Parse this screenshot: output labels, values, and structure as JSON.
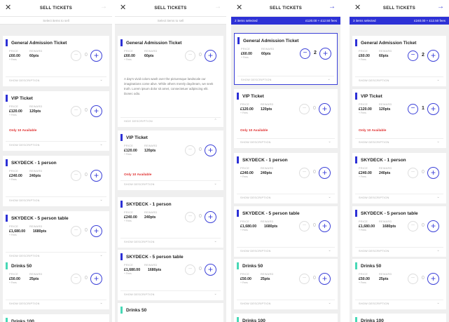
{
  "labels": {
    "close": "✕",
    "arrow": "→",
    "title": "SELL TICKETS",
    "subtitle": "Select items to sell",
    "price": "PRICE",
    "reward": "REWARD",
    "fees": "+ Fees",
    "show_description": "SHOW DESCRIPTION",
    "hide_description": "HIDE DESCRIPTION",
    "only_available": "Only 10 Available",
    "minus": "−",
    "plus": "+",
    "chevron": "⌄",
    "chevron_up": "⌃"
  },
  "screens": [
    {
      "id": "s1",
      "selection": null,
      "tickets": [
        {
          "name": "General Admission Ticket",
          "price": "£60.00",
          "reward": "60pts",
          "qty": "0"
        },
        {
          "name": "VIP Ticket",
          "price": "£120.00",
          "reward": "120pts",
          "qty": "0"
        },
        {
          "name": "SKYDECK - 1 person",
          "price": "£240.00",
          "reward": "240pts",
          "qty": "0"
        },
        {
          "name": "SKYDECK - 5 person table",
          "price": "£1,680.00",
          "reward": "1680pts",
          "qty": "0"
        },
        {
          "name": "Drinks 50",
          "price": "£50.00",
          "reward": "25pts",
          "qty": "0"
        },
        {
          "name": "Drinks 100"
        }
      ]
    },
    {
      "id": "s2",
      "selection": null,
      "description": "A day's vivid colors wash over the picturesque landscale our imaginations come alive. While others merely daydream, we seek truth. Lorem ipsum dolor sit amet, consectetuer adipiscing elit. Donec odio.",
      "tickets": [
        {
          "name": "General Admission Ticket",
          "price": "£60.00",
          "reward": "60pts",
          "qty": "0"
        },
        {
          "name": "VIP Ticket",
          "price": "£120.00",
          "reward": "120pts",
          "qty": "0"
        },
        {
          "name": "SKYDECK - 1 person",
          "price": "£240.00",
          "reward": "240pts",
          "qty": "0"
        },
        {
          "name": "SKYDECK - 5 person table",
          "price": "£1,680.00",
          "reward": "1680pts",
          "qty": "0"
        },
        {
          "name": "Drinks 50"
        }
      ]
    },
    {
      "id": "s3",
      "selection": {
        "items": "2 items selected",
        "total": "£120.00 + £12.50 fees"
      },
      "tickets": [
        {
          "name": "General Admission Ticket",
          "price": "£60.00",
          "reward": "60pts",
          "qty": "2"
        },
        {
          "name": "VIP Ticket",
          "price": "£120.00",
          "reward": "120pts",
          "qty": "0"
        },
        {
          "name": "SKYDECK - 1 person",
          "price": "£240.00",
          "reward": "240pts",
          "qty": "0"
        },
        {
          "name": "SKYDECK - 5 person table",
          "price": "£1,680.00",
          "reward": "1680pts",
          "qty": "0"
        },
        {
          "name": "Drinks 50",
          "price": "£50.00",
          "reward": "25pts",
          "qty": "0"
        },
        {
          "name": "Drinks 100"
        }
      ]
    },
    {
      "id": "s4",
      "selection": {
        "items": "3 items selected",
        "total": "£240.00 + £12.50 fees"
      },
      "tickets": [
        {
          "name": "General Admission Ticket",
          "price": "£60.00",
          "reward": "60pts",
          "qty": "2"
        },
        {
          "name": "VIP Ticket",
          "price": "£120.00",
          "reward": "120pts",
          "qty": "1"
        },
        {
          "name": "SKYDECK - 1 person",
          "price": "£240.00",
          "reward": "240pts",
          "qty": "0"
        },
        {
          "name": "SKYDECK - 5 person table",
          "price": "£1,680.00",
          "reward": "1680pts",
          "qty": "0"
        },
        {
          "name": "Drinks 50",
          "price": "£50.00",
          "reward": "25pts",
          "qty": "0"
        },
        {
          "name": "Drinks 100"
        }
      ]
    }
  ]
}
